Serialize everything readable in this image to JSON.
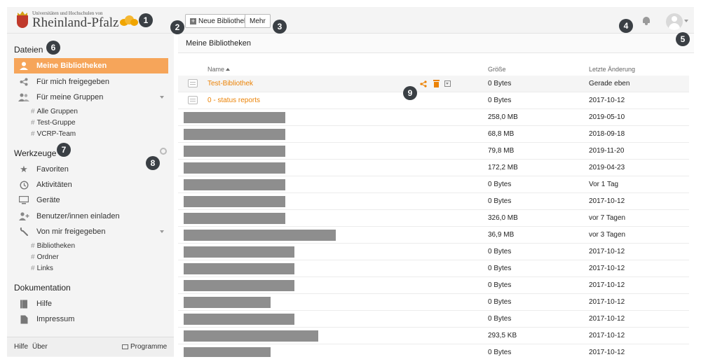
{
  "header": {
    "logo_top": "Universitäten und Hochschulen von",
    "logo_main": "Rheinland-Pfalz",
    "new_library_label": "Neue Bibliothek",
    "more_label": "Mehr"
  },
  "badges": [
    "1",
    "2",
    "3",
    "4",
    "5",
    "6",
    "7",
    "8",
    "9"
  ],
  "sidebar": {
    "files_title": "Dateien",
    "files_items": [
      {
        "label": "Meine Bibliotheken",
        "icon": "user-icon",
        "active": true
      },
      {
        "label": "Für mich freigegeben",
        "icon": "share-icon"
      },
      {
        "label": "Für meine Gruppen",
        "icon": "group-icon"
      }
    ],
    "groups": [
      "Alle Gruppen",
      "Test-Gruppe",
      "VCRP-Team"
    ],
    "tools_title": "Werkzeuge",
    "tools_items": [
      {
        "label": "Favoriten",
        "icon": "star-icon"
      },
      {
        "label": "Aktivitäten",
        "icon": "clock-icon"
      },
      {
        "label": "Geräte",
        "icon": "monitor-icon"
      },
      {
        "label": "Benutzer/innen einladen",
        "icon": "add-user-icon"
      },
      {
        "label": "Von mir freigegeben",
        "icon": "wrench-icon"
      }
    ],
    "shared_sub": [
      "Bibliotheken",
      "Ordner",
      "Links"
    ],
    "docs_title": "Dokumentation",
    "docs_items": [
      {
        "label": "Hilfe",
        "icon": "book-icon"
      },
      {
        "label": "Impressum",
        "icon": "document-icon"
      }
    ],
    "footer": {
      "help": "Hilfe",
      "about": "Über",
      "programs": "Programme"
    }
  },
  "main": {
    "title": "Meine Bibliotheken",
    "columns": {
      "name": "Name",
      "size": "Größe",
      "modified": "Letzte Änderung"
    },
    "rows": [
      {
        "name": "Test-Bibliothek",
        "size": "0 Bytes",
        "date": "Gerade eben"
      },
      {
        "name": "0 - status reports",
        "size": "0 Bytes",
        "date": "2017-10-12"
      },
      {
        "name": "",
        "size": "258,0 MB",
        "date": "2019-05-10"
      },
      {
        "name": "",
        "size": "68,8 MB",
        "date": "2018-09-18"
      },
      {
        "name": "",
        "size": "79,8 MB",
        "date": "2019-11-20"
      },
      {
        "name": "",
        "size": "172,2 MB",
        "date": "2019-04-23"
      },
      {
        "name": "",
        "size": "0 Bytes",
        "date": "Vor 1 Tag"
      },
      {
        "name": "",
        "size": "0 Bytes",
        "date": "2017-10-12"
      },
      {
        "name": "",
        "size": "326,0 MB",
        "date": "vor 7 Tagen"
      },
      {
        "name": "",
        "size": "36,9 MB",
        "date": "vor 3 Tagen"
      },
      {
        "name": "",
        "size": "0 Bytes",
        "date": "2017-10-12"
      },
      {
        "name": "",
        "size": "0 Bytes",
        "date": "2017-10-12"
      },
      {
        "name": "",
        "size": "0 Bytes",
        "date": "2017-10-12"
      },
      {
        "name": "",
        "size": "0 Bytes",
        "date": "2017-10-12"
      },
      {
        "name": "",
        "size": "0 Bytes",
        "date": "2017-10-12"
      },
      {
        "name": "",
        "size": "293,5 KB",
        "date": "2017-10-12"
      },
      {
        "name": "",
        "size": "0 Bytes",
        "date": "2017-10-12"
      }
    ]
  },
  "colors": {
    "accent": "#eb8205",
    "active_bg": "#f6a55a",
    "badge": "#3a3f44",
    "redaction": "#8e8e8e"
  }
}
